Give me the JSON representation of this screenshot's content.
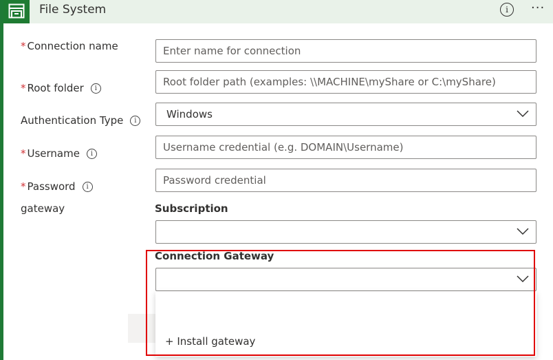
{
  "header": {
    "title": "File System",
    "info_glyph": "i",
    "more_glyph": "···",
    "icon": "file-system-icon"
  },
  "form": {
    "connection_name": {
      "label": "Connection name",
      "required": "*",
      "placeholder": "Enter name for connection"
    },
    "root_folder": {
      "label": "Root folder",
      "required": "*",
      "placeholder": "Root folder path (examples: \\\\MACHINE\\myShare or C:\\myShare)"
    },
    "auth_type": {
      "label": "Authentication Type",
      "value": "Windows"
    },
    "username": {
      "label": "Username",
      "required": "*",
      "placeholder": "Username credential (e.g. DOMAIN\\Username)"
    },
    "password": {
      "label": "Password",
      "required": "*",
      "placeholder": "Password credential"
    },
    "gateway_label": "gateway",
    "subscription": {
      "label": "Subscription",
      "value": ""
    },
    "connection_gateway": {
      "label": "Connection Gateway",
      "value": ""
    },
    "install_gateway": "+ Install gateway"
  },
  "info_glyph": "i",
  "colors": {
    "brand": "#1e7b32",
    "header_bg": "#e9f2e9",
    "required": "#d13438",
    "highlight": "#e00000"
  }
}
